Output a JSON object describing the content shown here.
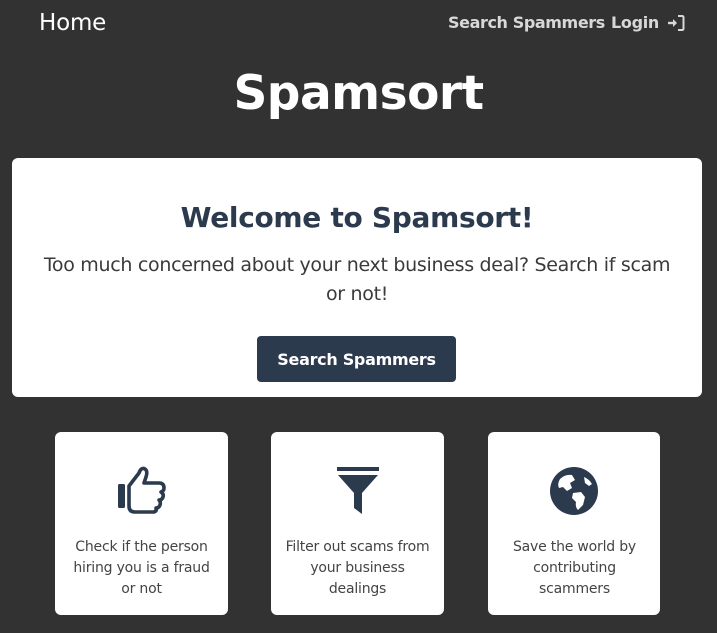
{
  "nav": {
    "home_label": "Home",
    "search_label": "Search Spammers",
    "login_label": "Login",
    "login_icon": "sign-in-icon"
  },
  "brand": {
    "title": "Spamsort"
  },
  "hero": {
    "title": "Welcome to Spamsort!",
    "subtitle": "Too much concerned about your next business deal? Search if scam or not!",
    "button_label": "Search Spammers"
  },
  "features": [
    {
      "icon": "thumbs-up-icon",
      "text": "Check if the person hiring you is a fraud or not"
    },
    {
      "icon": "filter-icon",
      "text": "Filter out scams from your business dealings"
    },
    {
      "icon": "globe-icon",
      "text": "Save the world by contributing scammers"
    }
  ],
  "colors": {
    "background": "#323232",
    "primary": "#2c3a4e",
    "card": "#ffffff"
  }
}
